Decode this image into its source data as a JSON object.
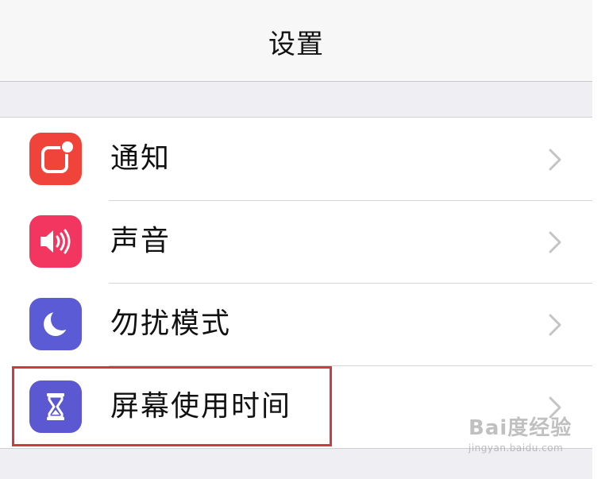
{
  "header": {
    "title": "设置"
  },
  "settings": {
    "items": [
      {
        "label": "通知",
        "icon": "notifications-icon",
        "color": "#f0443b"
      },
      {
        "label": "声音",
        "icon": "sounds-icon",
        "color": "#f2365f"
      },
      {
        "label": "勿扰模式",
        "icon": "do-not-disturb-moon-icon",
        "color": "#5b5bd6"
      },
      {
        "label": "屏幕使用时间",
        "icon": "screen-time-hourglass-icon",
        "color": "#5b58d1"
      }
    ]
  },
  "highlight_color": "#cc3b3f",
  "watermark": {
    "logo": "Bai度经验",
    "url": "jingyan.baidu.com"
  }
}
